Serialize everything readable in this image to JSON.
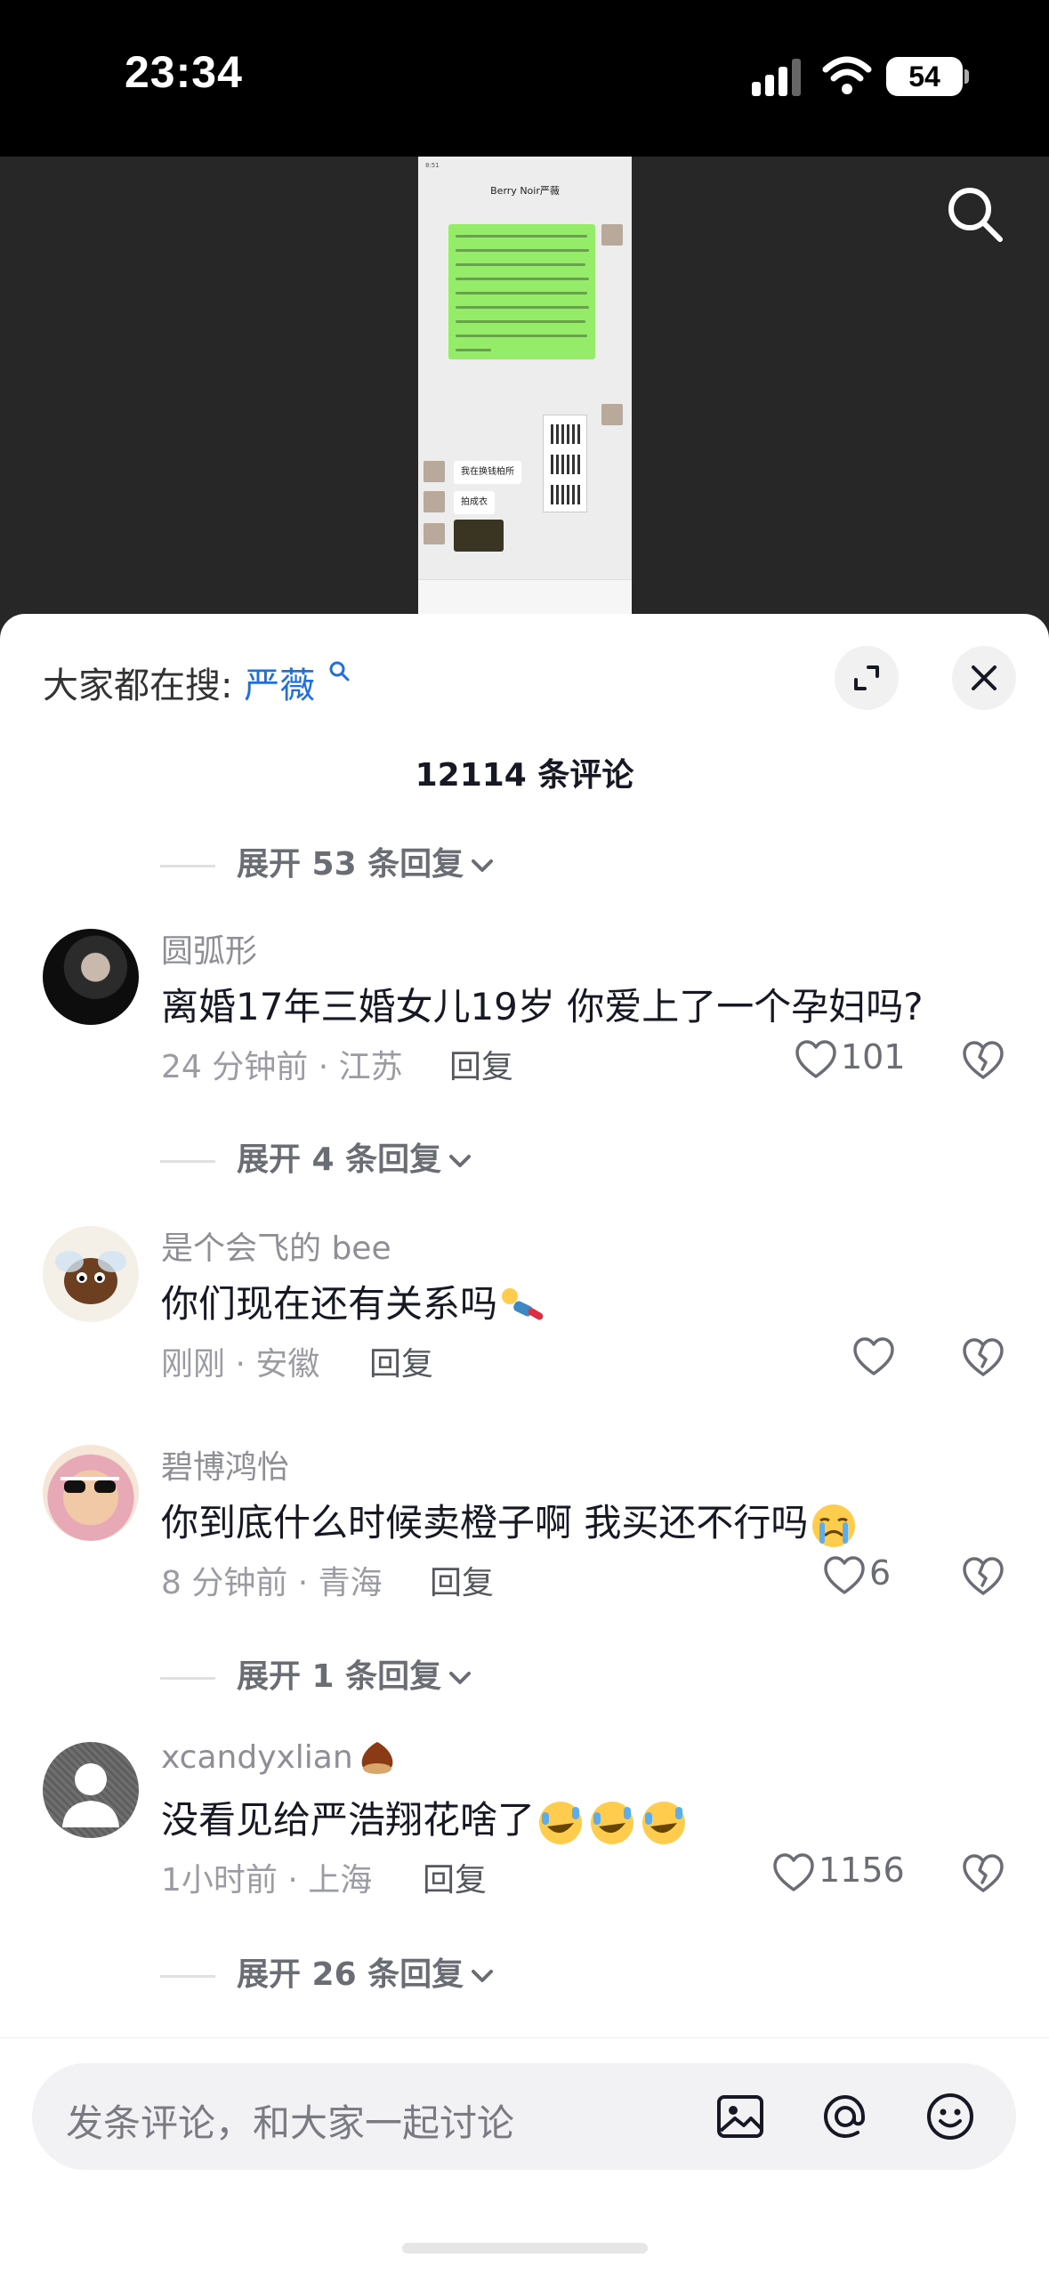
{
  "status": {
    "time": "23:34",
    "battery": "54"
  },
  "video": {
    "chat_title": "Berry Noir严薇",
    "chat_time": "8:51",
    "chat_bubbles": [
      "我在换钱柏所",
      "拍成衣"
    ]
  },
  "sheet": {
    "hot_label": "大家都在搜:",
    "hot_keyword": "严薇",
    "comment_count": "12114 条评论",
    "expand_top": "展开 53 条回复",
    "comments": [
      {
        "username": "圆弧形",
        "text": "离婚17年三婚女儿19岁 你爱上了一个孕妇吗?",
        "meta": "24 分钟前 · 江苏",
        "reply": "回复",
        "likes": "101",
        "expand": "展开 4 条回复"
      },
      {
        "username": "是个会飞的 bee",
        "text": "你们现在还有关系吗",
        "meta": "刚刚 · 安徽",
        "reply": "回复",
        "likes": ""
      },
      {
        "username": "碧博鸿怡",
        "text": "你到底什么时候卖橙子啊 我买还不行吗",
        "meta": "8 分钟前 · 青海",
        "reply": "回复",
        "likes": "6",
        "expand": "展开 1 条回复"
      },
      {
        "username": "xcandyxlian",
        "text": "没看见给严浩翔花啥了",
        "meta": "1小时前 · 上海",
        "reply": "回复",
        "likes": "1156",
        "expand": "展开 26 条回复"
      }
    ]
  },
  "input": {
    "placeholder": "发条评论，和大家一起讨论"
  },
  "icons": {
    "search": "search-icon",
    "expand": "expand-icon",
    "close": "close-icon",
    "heart": "heart-icon",
    "dislike": "broken-heart-icon",
    "image": "image-icon",
    "mention": "at-icon",
    "emoji": "smile-icon"
  }
}
